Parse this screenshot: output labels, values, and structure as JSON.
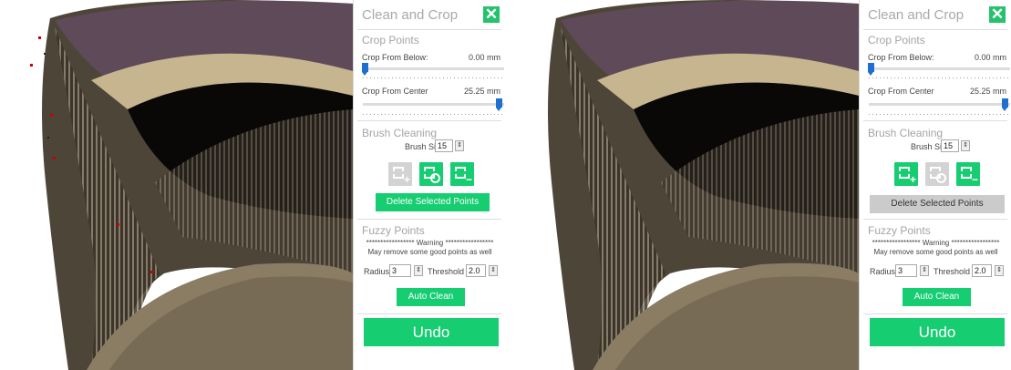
{
  "views": [
    {
      "panel": {
        "title": "Clean and Crop",
        "close_label": "✕",
        "crop": {
          "section": "Crop Points",
          "below_label": "Crop From Below:",
          "below_value": "0.00 mm",
          "center_label": "Crop From Center",
          "center_value": "25.25 mm"
        },
        "brush": {
          "section": "Brush Cleaning",
          "size_label": "Brush Size",
          "size_value": "15",
          "tools": [
            {
              "name": "add-selection",
              "active": false
            },
            {
              "name": "brush-select",
              "active": true
            },
            {
              "name": "remove-selection",
              "active": true
            }
          ],
          "delete_label": "Delete Selected Points"
        },
        "fuzzy": {
          "section": "Fuzzy Points",
          "warning": "***************** Warning *****************",
          "note": "May remove some good points as well",
          "radius_label": "Radius",
          "radius_value": "3",
          "threshold_label": "Threshold",
          "threshold_value": "2.0",
          "auto_label": "Auto Clean"
        },
        "undo_label": "Undo"
      }
    },
    {
      "panel": {
        "title": "Clean and Crop",
        "close_label": "✕",
        "crop": {
          "section": "Crop Points",
          "below_label": "Crop From Below:",
          "below_value": "0.00 mm",
          "center_label": "Crop From Center",
          "center_value": "25.25 mm"
        },
        "brush": {
          "section": "Brush Cleaning",
          "size_label": "Brush Size",
          "size_value": "15",
          "tools": [
            {
              "name": "add-selection",
              "active": true
            },
            {
              "name": "brush-select",
              "active": false
            },
            {
              "name": "remove-selection",
              "active": true
            }
          ],
          "delete_label": "Delete Selected Points"
        },
        "fuzzy": {
          "section": "Fuzzy Points",
          "warning": "***************** Warning *****************",
          "note": "May remove some good points as well",
          "radius_label": "Radius",
          "radius_value": "3",
          "threshold_label": "Threshold",
          "threshold_value": "2.0",
          "auto_label": "Auto Clean"
        },
        "undo_label": "Undo"
      }
    }
  ],
  "colors": {
    "accent": "#17cd72",
    "close": "#25c26e",
    "slider_thumb": "#1f6fd1",
    "disabled": "#cbcbcb"
  }
}
